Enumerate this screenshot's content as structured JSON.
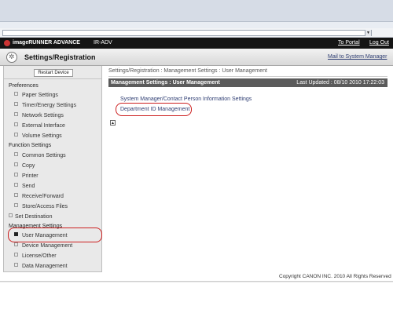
{
  "app": {
    "brand": "imageRUNNER ADVANCE",
    "device": "IR-ADV",
    "to_portal": "To Portal",
    "log_out": "Log Out",
    "page_title": "Settings/Registration",
    "mail_link": "Mail to System Manager"
  },
  "sidebar": {
    "restart": "Restart Device",
    "sections": {
      "preferences": "Preferences",
      "function": "Function Settings",
      "management": "Management Settings"
    },
    "items": [
      {
        "label": "Paper Settings"
      },
      {
        "label": "Timer/Energy Settings"
      },
      {
        "label": "Network Settings"
      },
      {
        "label": "External Interface"
      },
      {
        "label": "Volume Settings"
      },
      {
        "label": "Common Settings"
      },
      {
        "label": "Copy"
      },
      {
        "label": "Printer"
      },
      {
        "label": "Send"
      },
      {
        "label": "Receive/Forward"
      },
      {
        "label": "Store/Access Files"
      },
      {
        "label": "Set Destination"
      },
      {
        "label": "User Management"
      },
      {
        "label": "Device Management"
      },
      {
        "label": "License/Other"
      },
      {
        "label": "Data Management"
      }
    ]
  },
  "main": {
    "breadcrumb": "Settings/Registration : Management Settings : User Management",
    "panel_title": "Management Settings : User Management",
    "last_updated": "Last Updated : 08/10 2010 17:22:03",
    "links": [
      "System Manager/Contact Person Information Settings",
      "Department ID Management"
    ]
  },
  "footer": {
    "copyright": "Copyright CANON INC. 2010 All Rights Reserved"
  },
  "colors": {
    "header_bg": "#141414",
    "panel_bg": "#5b5b5b",
    "link": "#2f3e73",
    "highlight_ring": "#cc1f1f"
  }
}
